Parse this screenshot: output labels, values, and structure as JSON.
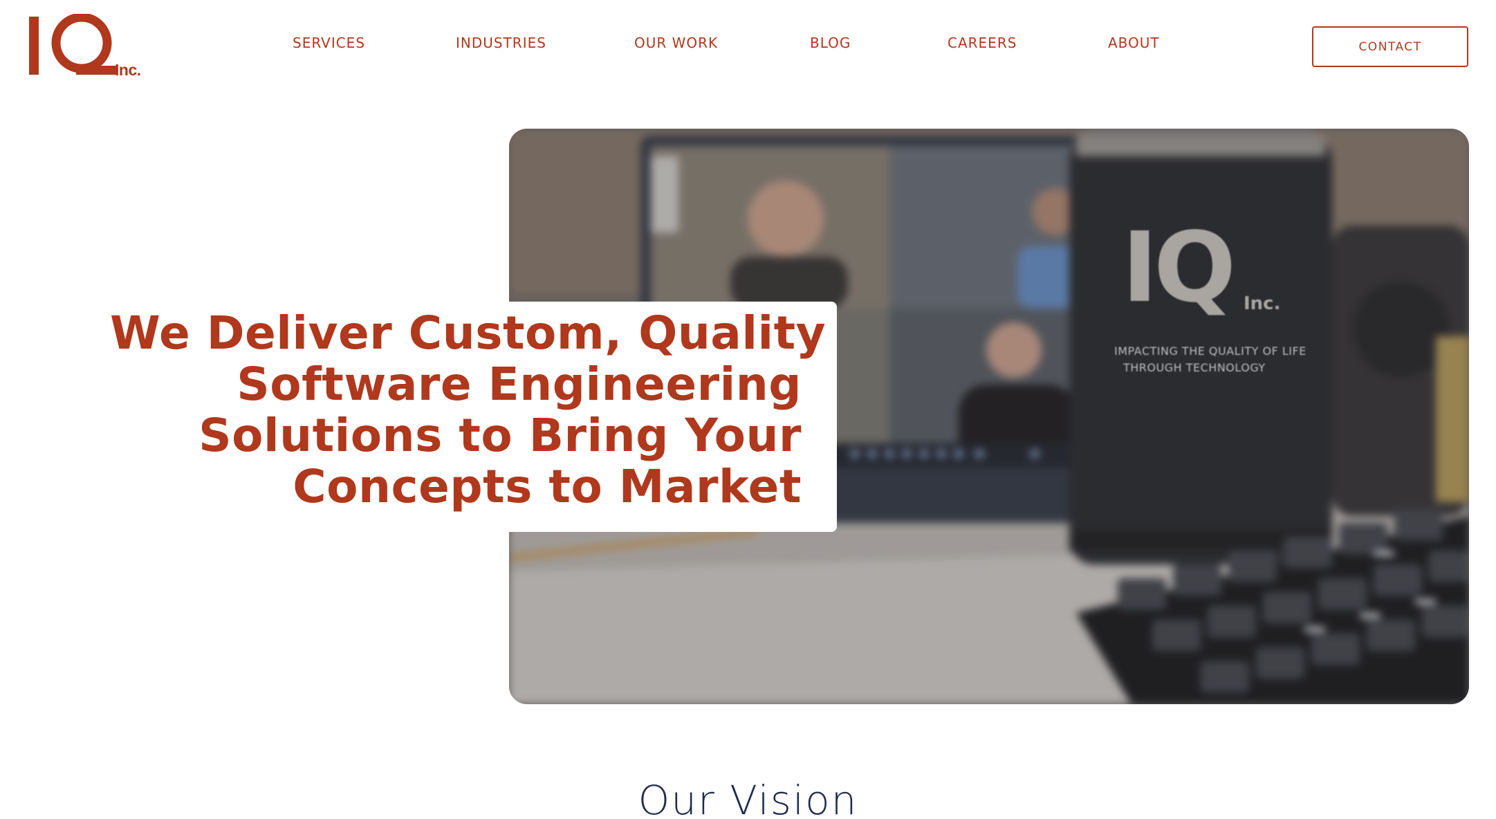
{
  "brand": {
    "logo_letters": "IQ",
    "logo_suffix": "Inc.",
    "accent_color": "#b0381c",
    "navy_color": "#1f2d4e"
  },
  "nav": {
    "items": [
      {
        "label": "SERVICES"
      },
      {
        "label": "INDUSTRIES"
      },
      {
        "label": "OUR WORK"
      },
      {
        "label": "BLOG"
      },
      {
        "label": "CAREERS"
      },
      {
        "label": "ABOUT"
      }
    ],
    "contact_label": "CONTACT"
  },
  "hero": {
    "heading_lines": [
      "We Deliver Custom, Quality",
      "Software Engineering",
      "Solutions to Bring Your",
      "Concepts to Market"
    ],
    "photo": {
      "mug_logo": "IQ",
      "mug_logo_suffix": "Inc.",
      "mug_tagline_1": "IMPACTING THE QUALITY OF LIFE",
      "mug_tagline_2": "THROUGH TECHNOLOGY"
    }
  },
  "vision": {
    "title": "Our Vision"
  }
}
